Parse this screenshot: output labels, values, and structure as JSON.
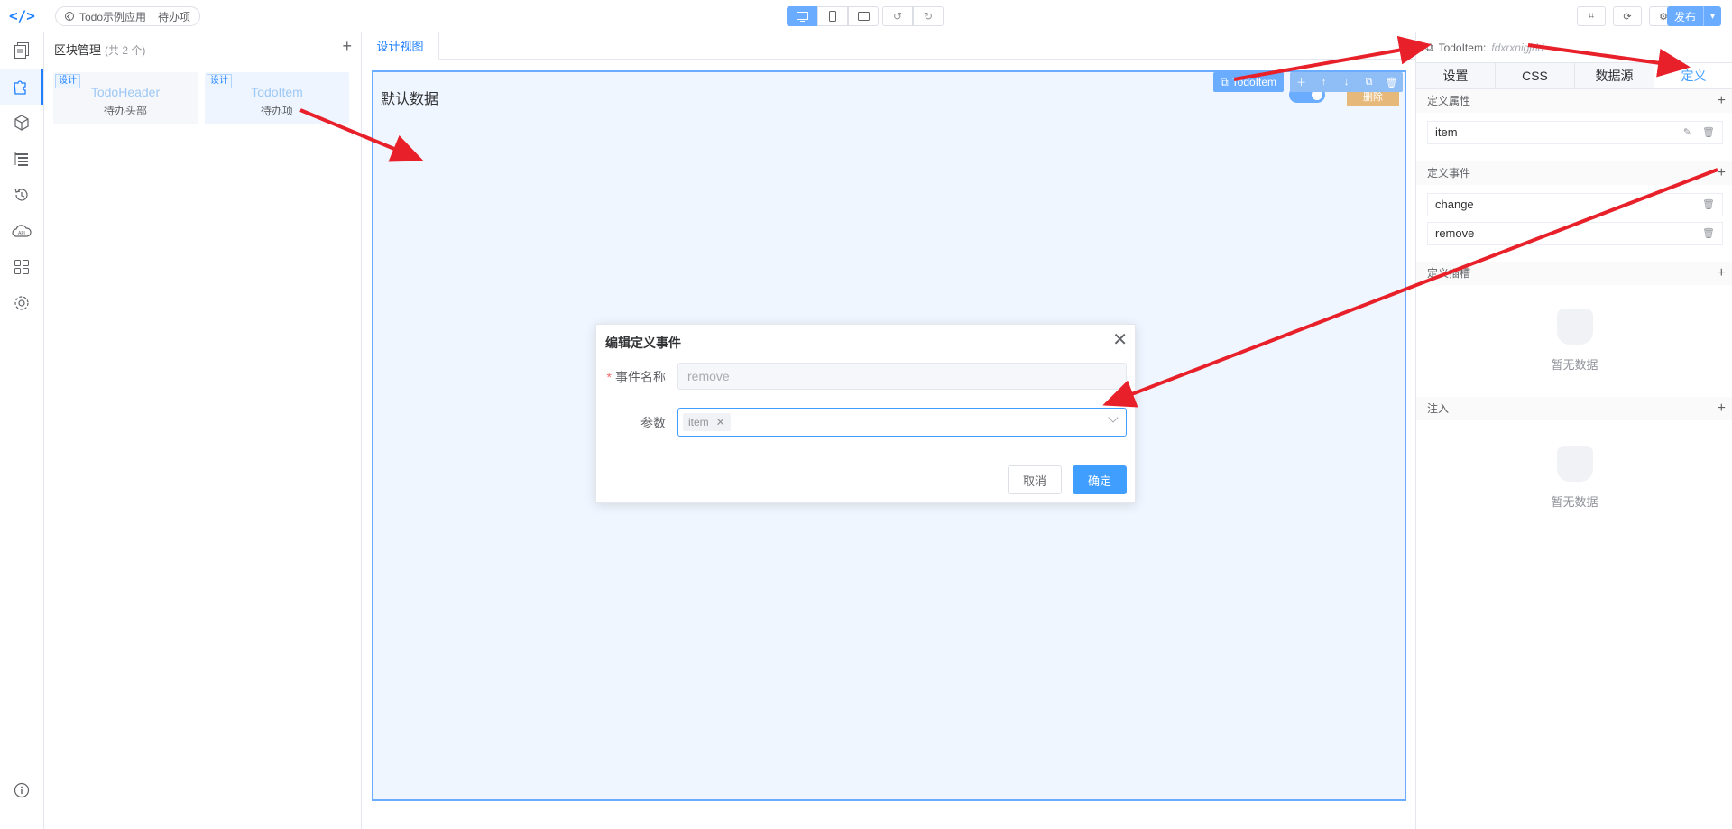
{
  "topbar": {
    "app_name": "Todo示例应用",
    "page_name": "待办项",
    "publish_label": "发布"
  },
  "block_panel": {
    "title": "区块管理",
    "count": "(共 2 个)",
    "blocks": [
      {
        "tag": "设计",
        "name": "TodoHeader",
        "sub": "待办头部"
      },
      {
        "tag": "设计",
        "name": "TodoItem",
        "sub": "待办项"
      }
    ]
  },
  "canvas": {
    "tab_label": "设计视图",
    "content_text": "默认数据",
    "selected_component": "TodoItem",
    "ghost_button_label": "删除"
  },
  "dialog": {
    "title": "编辑定义事件",
    "event_name_label": "事件名称",
    "event_name_value": "remove",
    "params_label": "参数",
    "params_chip": "item",
    "cancel_label": "取消",
    "ok_label": "确定"
  },
  "right_panel": {
    "component_name": "TodoItem:",
    "component_id": "fdxrxnigjrld",
    "tabs": [
      "设置",
      "CSS",
      "数据源",
      "定义"
    ],
    "active_tab": "定义",
    "sections": {
      "props_title": "定义属性",
      "props": [
        "item"
      ],
      "events_title": "定义事件",
      "events": [
        "change",
        "remove"
      ],
      "slots_title": "定义插槽",
      "inject_title": "注入",
      "empty_text": "暂无数据"
    }
  },
  "colors": {
    "accent": "#409eff",
    "arrow": "#e8202a"
  }
}
